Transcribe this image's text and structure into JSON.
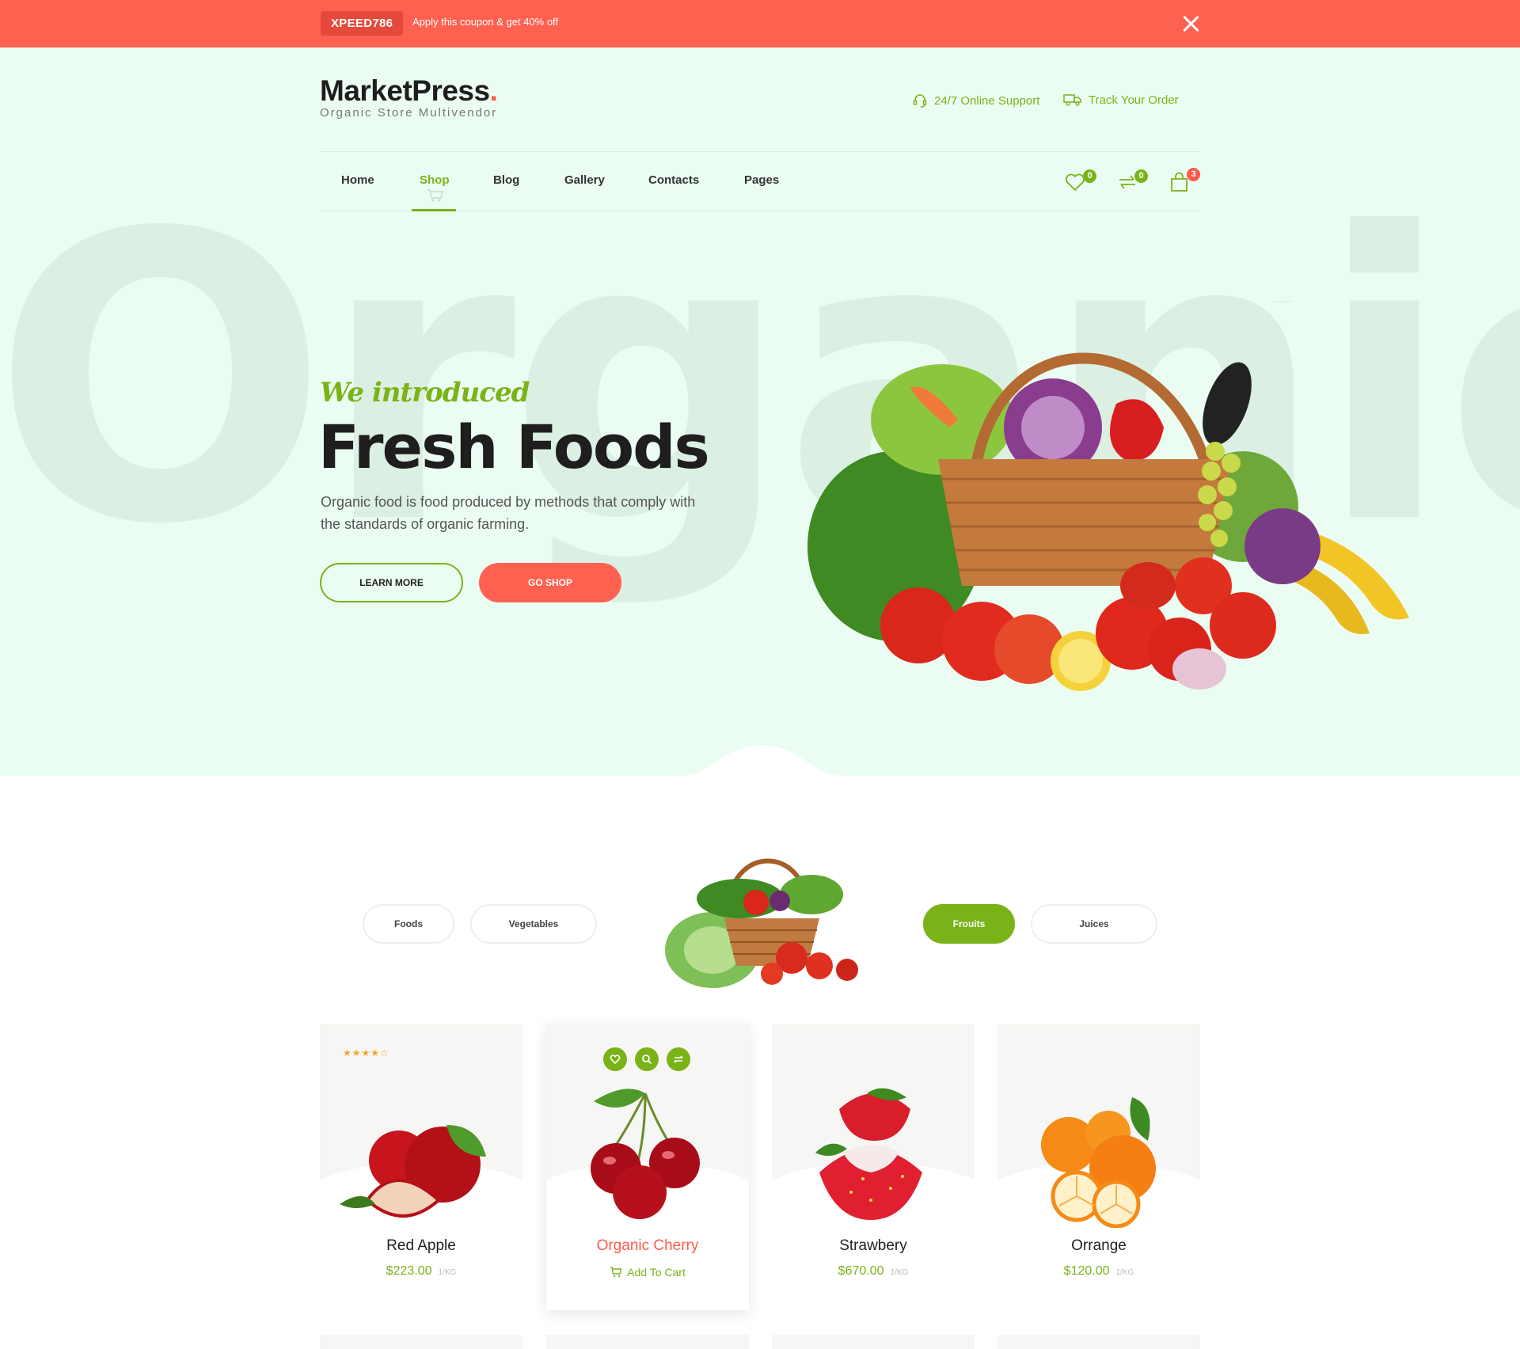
{
  "topbar": {
    "coupon_code": "XPEED786",
    "coupon_text": "Apply this coupon & get 40% off",
    "bg_color": "#ff6151"
  },
  "header": {
    "logo_title": "MarketPress",
    "logo_dot": ".",
    "logo_subtitle": "Organic Store Multivendor",
    "support_label": "24/7 Online Support",
    "track_label": "Track Your Order",
    "support_icon": "headset-icon",
    "track_icon": "truck-icon"
  },
  "nav": {
    "items": [
      "Home",
      "Shop",
      "Blog",
      "Gallery",
      "Contacts",
      "Pages"
    ],
    "active": "Shop",
    "wishlist_count": "0",
    "compare_count": "0",
    "cart_count": "3"
  },
  "hero": {
    "bg_word": "Organic",
    "script": "We introduced",
    "title": "Fresh Foods",
    "description": "Organic food is food produced by methods that comply with the standards of organic farming.",
    "learn_more": "LEARN MORE",
    "go_shop": "GO SHOP"
  },
  "categories": {
    "items": [
      "Foods",
      "Vegetables",
      "Frouits",
      "Juices"
    ],
    "active": "Frouits"
  },
  "products": [
    {
      "name": "Red Apple",
      "price": "$223.00",
      "unit": "1/KG",
      "rating": 4
    },
    {
      "name": "Organic Cherry",
      "add_to_cart": "Add To Cart",
      "hovered": true
    },
    {
      "name": "Strawbery",
      "price": "$670.00",
      "unit": "1/KG"
    },
    {
      "name": "Orrange",
      "price": "$120.00",
      "unit": "1/KG"
    }
  ],
  "colors": {
    "accent_green": "#7ab317",
    "accent_red": "#ff6151",
    "hero_bg": "#ebfdf2"
  }
}
